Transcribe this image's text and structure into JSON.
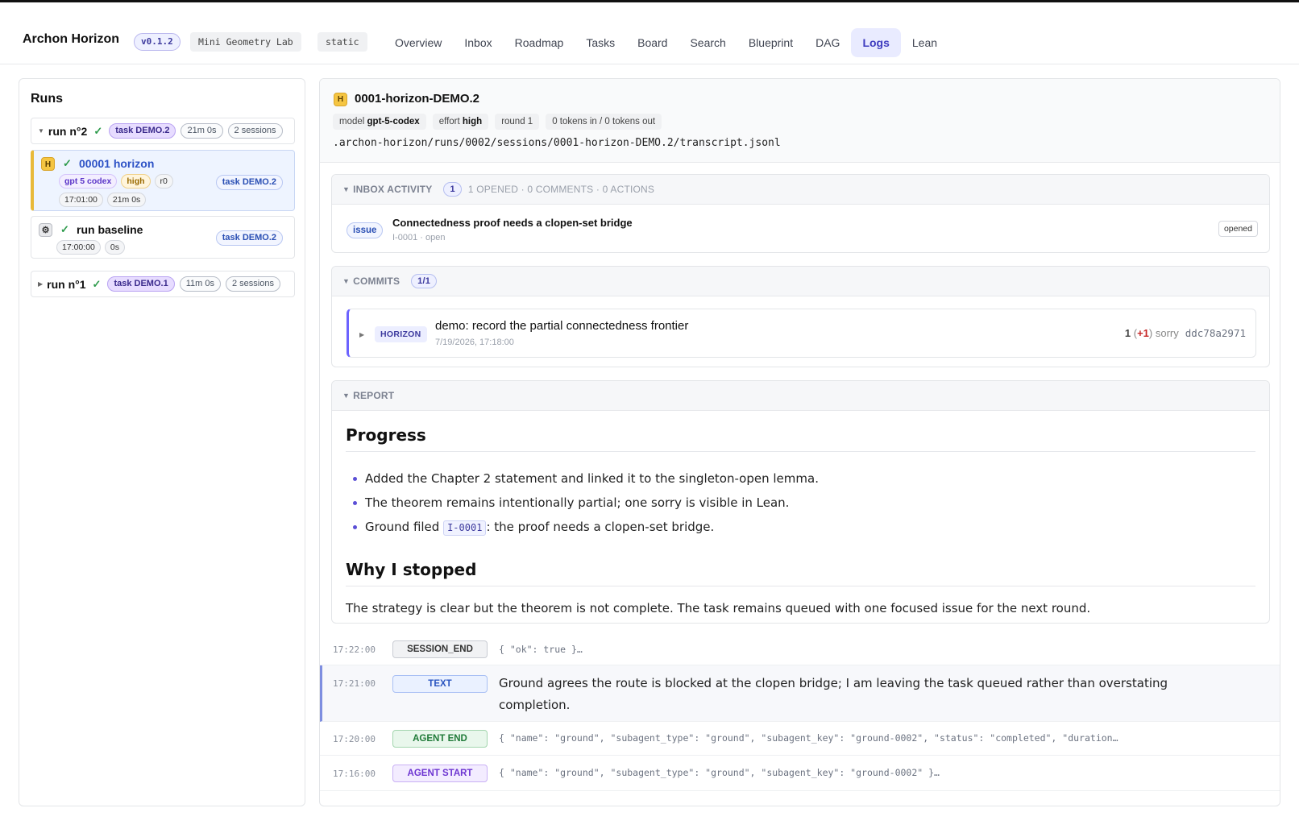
{
  "header": {
    "brand": "Archon Horizon",
    "version": "v0.1.2",
    "project": "Mini Geometry Lab",
    "mode": "static",
    "nav": [
      "Overview",
      "Inbox",
      "Roadmap",
      "Tasks",
      "Board",
      "Search",
      "Blueprint",
      "DAG",
      "Logs",
      "Lean"
    ],
    "active_nav": "Logs"
  },
  "runs_panel": {
    "title": "Runs",
    "runs": [
      {
        "name": "run n°2",
        "status_icon": "✓",
        "task": "task DEMO.2",
        "duration": "21m 0s",
        "sessions": "2 sessions",
        "expanded": true,
        "session_list": [
          {
            "badge": "H",
            "status_icon": "✓",
            "name": "00001 horizon",
            "model": "gpt 5 codex",
            "effort": "high",
            "round": "r0",
            "time": "17:01:00",
            "duration": "21m 0s",
            "task": "task DEMO.2",
            "active": true
          },
          {
            "badge": "⚙",
            "status_icon": "✓",
            "name": "run baseline",
            "time": "17:00:00",
            "duration": "0s",
            "task": "task DEMO.2",
            "active": false
          }
        ]
      },
      {
        "name": "run n°1",
        "status_icon": "✓",
        "task": "task DEMO.1",
        "duration": "11m 0s",
        "sessions": "2 sessions",
        "expanded": false
      }
    ]
  },
  "session_detail": {
    "badge": "H",
    "title": "0001-horizon-DEMO.2",
    "meta": {
      "model_label": "model",
      "model": "gpt-5-codex",
      "effort_label": "effort",
      "effort": "high",
      "round": "round 1",
      "tokens": "0 tokens in / 0 tokens out"
    },
    "path": ".archon-horizon/runs/0002/sessions/0001-horizon-DEMO.2/transcript.jsonl"
  },
  "inbox_activity": {
    "label": "INBOX ACTIVITY",
    "count": "1",
    "summary": "1 OPENED · 0 COMMENTS · 0 ACTIONS",
    "item": {
      "kind": "issue",
      "title": "Connectedness proof needs a clopen-set bridge",
      "sub": "I-0001 · open",
      "status": "opened"
    }
  },
  "commits": {
    "label": "COMMITS",
    "count": "1/1",
    "item": {
      "tag": "HORIZON",
      "message": "demo: record the partial connectedness frontier",
      "date": "7/19/2026, 17:18:00",
      "sorry_num": "1",
      "sorry_delta": "+1",
      "sorry_label": "sorry",
      "hash": "ddc78a2971"
    }
  },
  "report": {
    "label": "REPORT",
    "progress_heading": "Progress",
    "bullets": [
      "Added the Chapter 2 statement and linked it to the singleton-open lemma.",
      "The theorem remains intentionally partial; one sorry is visible in Lean."
    ],
    "bullet3_prefix": "Ground filed ",
    "bullet3_code": "I-0001",
    "bullet3_suffix": ": the proof needs a clopen-set bridge.",
    "stop_heading": "Why I stopped",
    "stop_text": "The strategy is clear but the theorem is not complete. The task remains queued with one focused issue for the next round."
  },
  "log": [
    {
      "time": "17:22:00",
      "type": "SESSION_END",
      "content": "{ \"ok\": true }…"
    },
    {
      "time": "17:21:00",
      "type": "TEXT",
      "content": "Ground agrees the route is blocked at the clopen bridge; I am leaving the task queued rather than overstating completion."
    },
    {
      "time": "17:20:00",
      "type": "AGENT END",
      "content": "{ \"name\": \"ground\", \"subagent_type\": \"ground\", \"subagent_key\": \"ground-0002\", \"status\": \"completed\", \"duration…"
    },
    {
      "time": "17:16:00",
      "type": "AGENT START",
      "content": "{ \"name\": \"ground\", \"subagent_type\": \"ground\", \"subagent_key\": \"ground-0002\" }…"
    }
  ],
  "colors": {
    "accent": "#3f3cbf",
    "active_session_border": "#e8b93a",
    "success": "#2e9b4c"
  },
  "icons": {
    "collapse": "caret-down-icon",
    "expand": "caret-right-icon",
    "status": "check-icon",
    "horizon_badge": "horizon-badge-icon",
    "baseline_badge": "gear-icon"
  }
}
